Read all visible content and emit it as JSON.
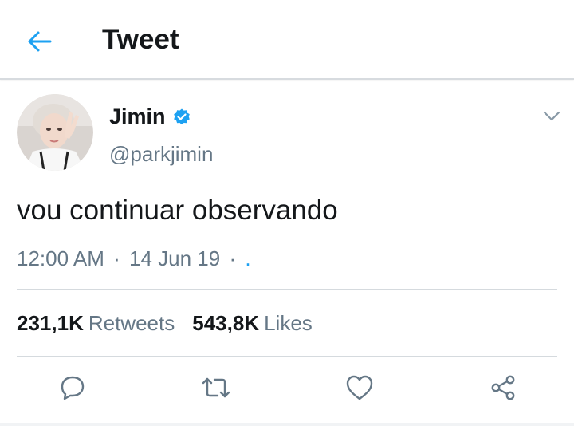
{
  "header": {
    "title": "Tweet",
    "back_icon": "arrow-left-icon"
  },
  "author": {
    "display_name": "Jimin",
    "handle": "@parkjimin",
    "verified_icon": "verified-badge-icon",
    "menu_icon": "chevron-down-icon"
  },
  "tweet": {
    "text": "vou continuar observando",
    "time": "12:00 AM",
    "separator": "·",
    "date": "14 Jun 19",
    "source": "."
  },
  "stats": {
    "retweets_count": "231,1K",
    "retweets_label": "Retweets",
    "likes_count": "543,8K",
    "likes_label": "Likes"
  },
  "actions": {
    "reply_icon": "reply-icon",
    "retweet_icon": "retweet-icon",
    "like_icon": "heart-icon",
    "share_icon": "share-icon"
  },
  "colors": {
    "accent": "#1da1f2",
    "text": "#14171a",
    "secondary": "#657786",
    "divider": "#d5dade"
  }
}
